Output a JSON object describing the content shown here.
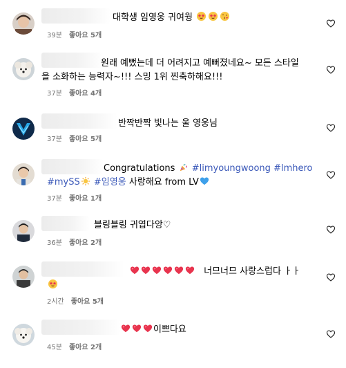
{
  "comments": [
    {
      "text": "대학생 임영웅 귀여웡",
      "time": "39분",
      "likes": "좋아요 5개"
    },
    {
      "text_line1": "원래 예뻤는데 더 어려지고 예뻐졌네요~ 모든 스타일",
      "text_line2": "을 소화하는 능력자~!!! 스밍 1위 찐축하해요!!!",
      "time": "37분",
      "likes": "좋아요 4개"
    },
    {
      "text": "반짝반짝 빛나는 울 영웅님",
      "time": "37분",
      "likes": "좋아요 5개"
    },
    {
      "text_part1": "Congratulations",
      "hashtag1": "#limyoungwoong",
      "hashtag2": "#lmhero",
      "hashtag3": "#mySS",
      "hashtag4": "#임영웅",
      "text_part2": "사랑해요 from LV",
      "time": "37분",
      "likes": "좋아요 1개"
    },
    {
      "text": "블링블링 귀엽다앙♡",
      "time": "36분",
      "likes": "좋아요 2개"
    },
    {
      "text": "너므너므 사랑스럽다 ㅏㅏ",
      "time": "2시간",
      "likes": "좋아요 5개"
    },
    {
      "text": "이쁘다요",
      "time": "45분",
      "likes": "좋아요 2개"
    }
  ],
  "icons": {
    "like": "heart-outline-icon",
    "heart_emoji": "red-heart-emoji",
    "star_eyes_emoji": "star-struck-emoji",
    "kiss_emoji": "face-blowing-kiss-emoji",
    "party_emoji": "party-popper-emoji",
    "sun_emoji": "sun-emoji",
    "blue_heart_emoji": "blue-heart-emoji"
  },
  "colors": {
    "hashtag": "#3b59b9",
    "meta": "#737373",
    "heart": "#e8344e"
  }
}
